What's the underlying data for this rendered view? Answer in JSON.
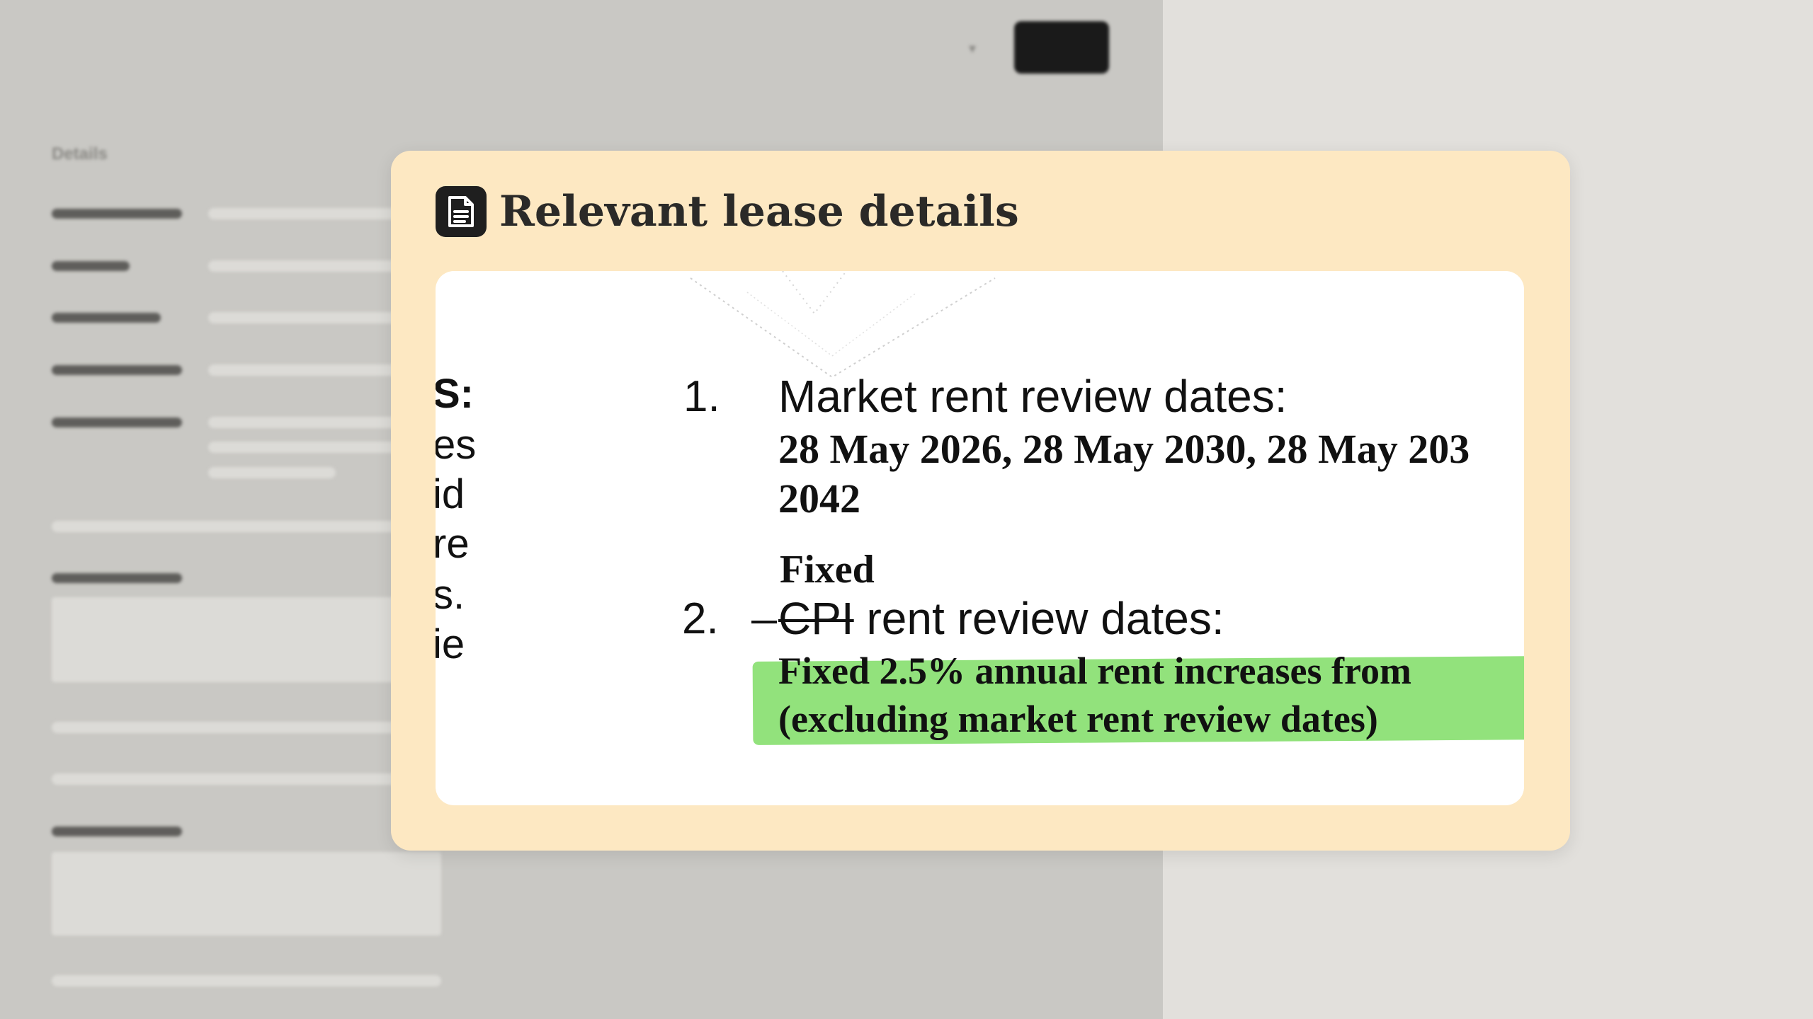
{
  "background": {
    "details_label": "Details"
  },
  "card": {
    "icon": "document-icon",
    "title": "Relevant lease details",
    "excerpt": {
      "left_fragments": [
        "S:",
        "es",
        "id",
        "re",
        "s.",
        "ie"
      ],
      "item1_number": "1.",
      "item1_heading": "Market rent review dates:",
      "item1_dates_line1": "28 May 2026, 28 May 2030, 28 May 203",
      "item1_dates_line2": "2042",
      "item2_handwritten": "Fixed",
      "item2_number": "2.",
      "item2_struck": "CPI",
      "item2_heading": " rent review dates:",
      "item2_line1": "Fixed 2.5% annual rent increases from",
      "item2_line2": "(excluding market rent review dates)"
    }
  },
  "colors": {
    "card_bg": "#fde8c2",
    "highlight": "#92e27c",
    "icon_bg": "#1f1f1f"
  }
}
